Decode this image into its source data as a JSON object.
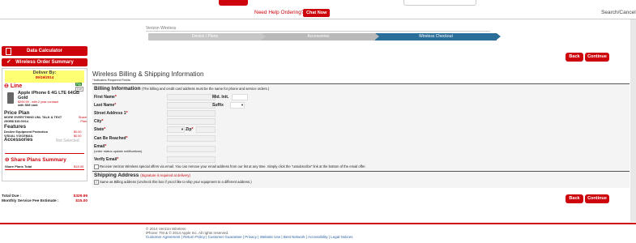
{
  "header": {
    "help_text": "Need Help Ordering?",
    "chat_label": "Chat Now",
    "search_cancel": "Search/Cancel"
  },
  "breadcrumb": "Verizon Wireless",
  "steps": [
    "Device / Plans",
    "Accessories",
    "Wireless Checkout"
  ],
  "sidebar": {
    "calculator": "Data Calculator",
    "summary_title": "Wireless Order Summary",
    "deliver_by_label": "Deliver By:",
    "deliver_by_date": "09/19/2014",
    "line_label": "Line",
    "pay_label": "Pay",
    "edit_label": "Edit",
    "device_name": "Apple iPhone 6 4G LTE 64GB Gold",
    "device_price": "$299.99 - with 2 year contract",
    "sim": "with SIM card",
    "price_plan_heading": "Price Plan",
    "plan_name": "MORE EVERYTHING UNL TALK & TEXT 25GB$ $15.00/14",
    "share_label": "Share Plan",
    "features_heading": "Features",
    "features": [
      {
        "name": "Decline Equipment Protection",
        "price": "$0.00"
      },
      {
        "name": "VISUAL VOICEMAIL",
        "price": "$0.00"
      }
    ],
    "accessories_label": "Accessories",
    "accessories_value": "Not Selected",
    "share_summary_title": "Share Plans Summary",
    "share_total_label": "Share Plans Total",
    "share_total_value": "$15.00",
    "total_due_label": "Total Due :",
    "total_due_value": "$329.99",
    "monthly_label": "Monthly Service Fee Estimate :",
    "monthly_value": "$15.00"
  },
  "actions": {
    "back": "Back",
    "continue": "Continue"
  },
  "main": {
    "title": "Wireless Billing & Shipping Information",
    "required_note": "Indicates Required Fields",
    "billing_heading": "Billing Information",
    "billing_note": "(The billing and credit card address must be the same for phone and service orders.)",
    "labels": {
      "first_name": "First Name",
      "mid_init": "Mid. Init.",
      "last_name": "Last Name",
      "suffix": "Suffix",
      "street": "Street Address 1",
      "city": "City",
      "state": "State",
      "zip": "Zip",
      "can_be_reached": "Can Be Reached",
      "email": "Email",
      "email_note": "(order status update notifications)",
      "verify_email": "Verify Email"
    },
    "offers_text": "Receive Verizon Wireless special offers via email. You can remove your email address from our list at any time. Simply click the \"unsubscribe\" link at the bottom of the email offer.",
    "shipping_heading": "Shipping Address",
    "shipping_note": "(Signature is required at delivery)",
    "same_as_billing": "Same as Billing address (Uncheck this box if you'd like to ship your equipment to a different address.)"
  },
  "footer": {
    "line1": "© 2014 Verizon Wireless",
    "line2": "iPhone: TM & © 2014 Apple Inc. All rights reserved.",
    "links": "Customer Agreement | Return Policy | Customer Guarantee | Privacy | Website Use | Best Network | Accessibility | Legal Notices"
  }
}
